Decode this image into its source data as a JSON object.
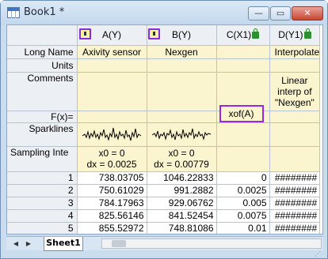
{
  "window": {
    "title": "Book1 *",
    "min_label": "—",
    "max_label": "▭",
    "close_label": "✕"
  },
  "columns": [
    {
      "header": "A(Y)",
      "long_name": "Axivity sensor",
      "units": "",
      "comments": "",
      "fx": "",
      "sampling_line1": "x0 = 0",
      "sampling_line2": "dx = 0.0025"
    },
    {
      "header": "B(Y)",
      "long_name": "Nexgen",
      "units": "",
      "comments": "",
      "fx": "",
      "sampling_line1": "x0 = 0",
      "sampling_line2": "dx = 0.00779"
    },
    {
      "header": "C(X1)",
      "long_name": "",
      "units": "",
      "comments": "",
      "fx": "xof(A)",
      "sampling_line1": "",
      "sampling_line2": ""
    },
    {
      "header": "D(Y1)",
      "long_name": "Interpolate",
      "units": "",
      "comments_line1": "Linear",
      "comments_line2": "interp of",
      "comments_line3": "\"Nexgen\"",
      "fx": "",
      "sampling_line1": "",
      "sampling_line2": ""
    }
  ],
  "row_labels": {
    "long_name": "Long Name",
    "units": "Units",
    "comments": "Comments",
    "fx": "F(x)=",
    "sparklines": "Sparklines",
    "sampling": "Sampling Inte"
  },
  "rows": [
    {
      "n": "1",
      "a": "738.03705",
      "b": "1046.22833",
      "c": "0",
      "d": "########"
    },
    {
      "n": "2",
      "a": "750.61029",
      "b": "991.2882",
      "c": "0.0025",
      "d": "########"
    },
    {
      "n": "3",
      "a": "784.17963",
      "b": "929.06762",
      "c": "0.005",
      "d": "########"
    },
    {
      "n": "4",
      "a": "825.56146",
      "b": "841.52454",
      "c": "0.0075",
      "d": "########"
    },
    {
      "n": "5",
      "a": "855.52972",
      "b": "748.81086",
      "c": "0.01",
      "d": "########"
    }
  ],
  "sheet_tab": "Sheet1",
  "nav": {
    "prev": "◀",
    "next": "▶"
  }
}
